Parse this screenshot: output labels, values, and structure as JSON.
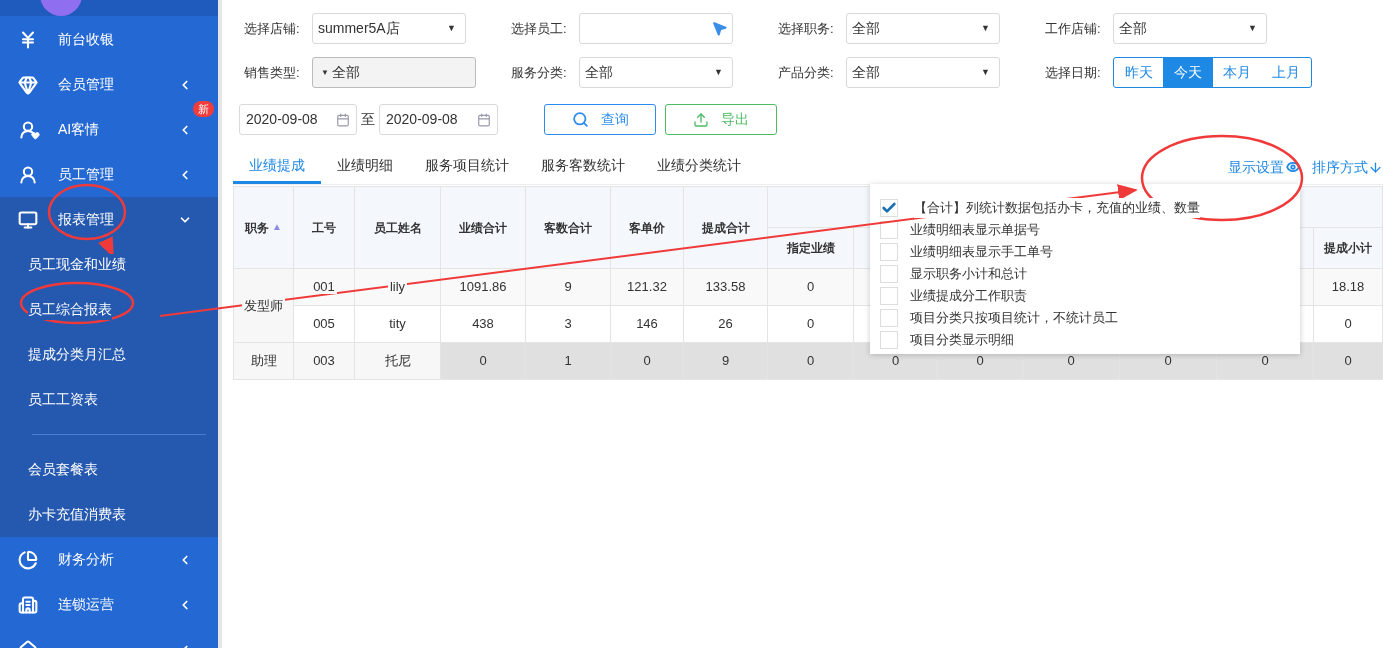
{
  "sidebar": {
    "badge": "新",
    "items": [
      {
        "label": "前台收银",
        "has_arrow": false,
        "expanded": false
      },
      {
        "label": "会员管理",
        "has_arrow": true,
        "expanded": false
      },
      {
        "label": "AI客情",
        "has_arrow": true,
        "expanded": false,
        "badge": true
      },
      {
        "label": "员工管理",
        "has_arrow": true,
        "expanded": false
      },
      {
        "label": "报表管理",
        "has_arrow": true,
        "expanded": true,
        "sections": [
          [
            "员工现金和业绩",
            "员工综合报表",
            "提成分类月汇总",
            "员工工资表"
          ],
          [
            "会员套餐表",
            "办卡充值消费表"
          ]
        ]
      },
      {
        "label": "财务分析",
        "has_arrow": true,
        "expanded": false
      },
      {
        "label": "连锁运营",
        "has_arrow": true,
        "expanded": false
      },
      {
        "has_arrow": true,
        "expanded": false
      }
    ]
  },
  "filters": {
    "caret": "▼",
    "rows": [
      [
        {
          "label": "选择店铺:",
          "kind": "select",
          "value": "summer5A店"
        },
        {
          "label": "选择员工:",
          "kind": "picker"
        },
        {
          "label": "选择职务:",
          "kind": "select",
          "value": "全部"
        },
        {
          "label": "工作店铺:",
          "kind": "select",
          "value": "全部"
        }
      ],
      [
        {
          "label": "销售类型:",
          "kind": "disabled",
          "value": "全部"
        },
        {
          "label": "服务分类:",
          "kind": "select",
          "value": "全部"
        },
        {
          "label": "产品分类:",
          "kind": "select",
          "value": "全部"
        },
        {
          "label": "选择日期:",
          "kind": "segments",
          "options": [
            {
              "label": "昨天",
              "selected": false
            },
            {
              "label": "今天",
              "selected": true
            },
            {
              "label": "本月",
              "selected": false
            },
            {
              "label": "上月",
              "selected": false
            }
          ]
        }
      ]
    ],
    "date_from": "2020-09-08",
    "date_sep": "至",
    "date_to": "2020-09-08",
    "query_button": "查询",
    "export_button": "导出"
  },
  "tabs": [
    {
      "label": "业绩提成",
      "selected": true
    },
    {
      "label": "业绩明细",
      "selected": false
    },
    {
      "label": "服务项目统计",
      "selected": false
    },
    {
      "label": "服务客数统计",
      "selected": false
    },
    {
      "label": "业绩分类统计",
      "selected": false
    }
  ],
  "display_settings": "显示设置",
  "sort_order": "排序方式",
  "table": {
    "sort_mark": "▲",
    "columns": [
      "职务",
      "工号",
      "员工姓名",
      "业绩合计",
      "客数合计",
      "客单价",
      "提成合计"
    ],
    "sub_columns": [
      "指定业绩",
      "提成小计"
    ],
    "groups": [
      {
        "role": "发型师",
        "rows": [
          {
            "cells": [
              "001",
              "lily",
              "1091.86",
              "9",
              "121.32",
              "133.58",
              "0"
            ],
            "commission_subtotal": "18.18",
            "shaded": false
          },
          {
            "cells": [
              "005",
              "tity",
              "438",
              "3",
              "146",
              "26",
              "0"
            ],
            "commission_subtotal": "0",
            "shaded": false
          }
        ]
      },
      {
        "role": "助理",
        "rows": [
          {
            "cells": [
              "003",
              "托尼",
              "0",
              "1",
              "0",
              "9",
              "0"
            ],
            "covered_cells": [
              "0",
              "0",
              "0",
              "0",
              "0"
            ],
            "commission_subtotal": "0",
            "shaded": true
          }
        ]
      }
    ]
  },
  "settings_popup": {
    "options": [
      {
        "label": "【合计】列统计数据包括办卡，充值的业绩、数量",
        "checked": true
      },
      {
        "label": "业绩明细表显示单据号",
        "checked": false
      },
      {
        "label": "业绩明细表显示手工单号",
        "checked": false
      },
      {
        "label": "显示职务小计和总计",
        "checked": false
      },
      {
        "label": "业绩提成分工作职责",
        "checked": false
      },
      {
        "label": "项目分类只按项目统计，不统计员工",
        "checked": false
      },
      {
        "label": "项目分类显示明细",
        "checked": false
      }
    ]
  }
}
